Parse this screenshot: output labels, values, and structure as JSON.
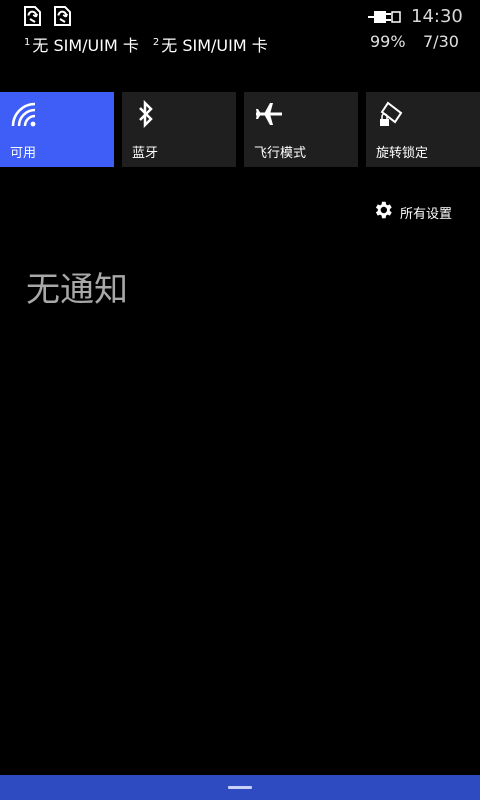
{
  "status_bar": {
    "sim_icons": [
      "sim-1-no-sim-icon",
      "sim-2-no-sim-icon"
    ],
    "sim1": {
      "index": "1",
      "label": "无 SIM/UIM 卡"
    },
    "sim2": {
      "index": "2",
      "label": "无 SIM/UIM 卡"
    },
    "battery_icon": "battery-charging-icon",
    "time": "14:30",
    "battery_percent": "99%",
    "date": "7/30"
  },
  "quick_actions": [
    {
      "label": "可用",
      "icon": "wifi-icon",
      "active": true
    },
    {
      "label": "蓝牙",
      "icon": "bluetooth-icon",
      "active": false
    },
    {
      "label": "飞行模式",
      "icon": "airplane-icon",
      "active": false
    },
    {
      "label": "旋转锁定",
      "icon": "rotation-lock-icon",
      "active": false
    }
  ],
  "all_settings": {
    "label": "所有设置",
    "icon": "gear-icon"
  },
  "notifications": {
    "empty_text": "无通知"
  },
  "colors": {
    "accent": "#3f5ef7",
    "tile_bg": "#1f1f1f",
    "bottom_bar": "#2f4bc2",
    "empty_text": "#a8a8a8"
  }
}
